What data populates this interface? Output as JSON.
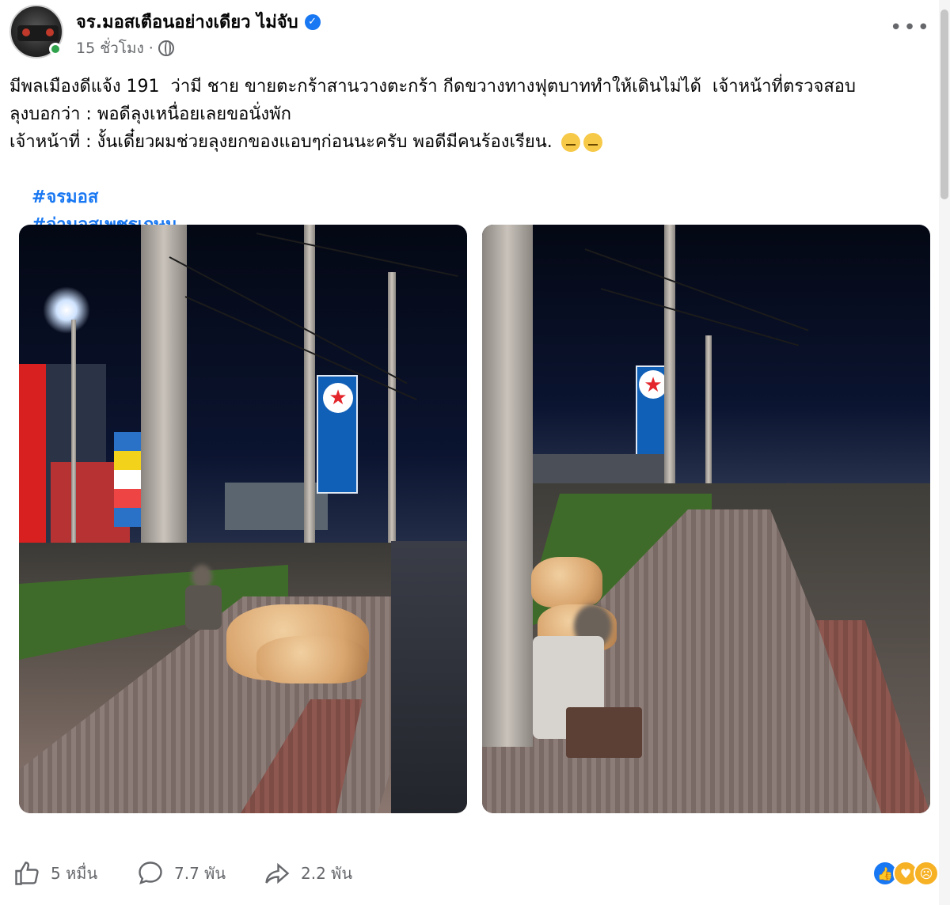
{
  "post": {
    "page_name": "จร.มอสเตือนอย่างเดียว ไม่จับ",
    "verified_icon": "verified-badge-icon",
    "time": "15 ชั่วโมง",
    "separator": "·",
    "privacy_icon": "globe-icon",
    "more_label": "•••",
    "text_lines": [
      "มีพลเมืองดีแจ้ง 191  ว่ามี ชาย ขายตะกร้าสานวางตะกร้า กีดขวางทางฟุตบาททำให้เดินไม่ได้  เจ้าหน้าที่ตรวจสอบ",
      "ลุงบอกว่า : พอดีลุงเหนื่อยเลยขอนั่งพัก",
      "เจ้าหน้าที่ : งั้นเดี๋ยวผมช่วยลุงยกของแอบๆก่อนนะครับ พอดีมีคนร้องเรียน."
    ],
    "emojis": [
      "pensive-face-emoji",
      "pensive-face-emoji"
    ],
    "hashtags": [
      "#จรมอส",
      "#จ่ามอสเพชรเกษม"
    ]
  },
  "photos": [
    {
      "name": "photo-night-sidewalk-wide"
    },
    {
      "name": "photo-night-sidewalk-closeup"
    }
  ],
  "actions": {
    "like": {
      "icon": "thumbs-up-icon",
      "label": "5 หมื่น"
    },
    "comment": {
      "icon": "comment-bubble-icon",
      "label": "7.7 พัน"
    },
    "share": {
      "icon": "share-arrow-icon",
      "label": "2.2 พัน"
    }
  },
  "reactions": [
    "like-reaction-icon",
    "care-reaction-icon",
    "sad-reaction-icon"
  ],
  "colors": {
    "link": "#1877f2",
    "secondary_text": "#65676b",
    "online": "#31a24c"
  }
}
